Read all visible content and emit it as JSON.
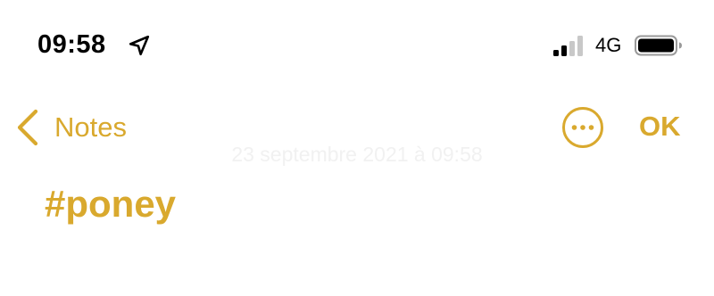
{
  "status_bar": {
    "time": "09:58",
    "location_icon": "location-arrow-icon",
    "signal_icon": "cellular-signal-icon",
    "network": "4G",
    "battery_icon": "battery-icon"
  },
  "nav": {
    "back_label": "Notes",
    "back_icon": "chevron-left-icon",
    "more_icon": "ellipsis-circle-icon",
    "done_label": "OK"
  },
  "note": {
    "date": "23 septembre 2021 à 09:58",
    "body": "#poney"
  },
  "colors": {
    "accent": "#d9a92e",
    "text": "#000000",
    "background": "#ffffff"
  }
}
